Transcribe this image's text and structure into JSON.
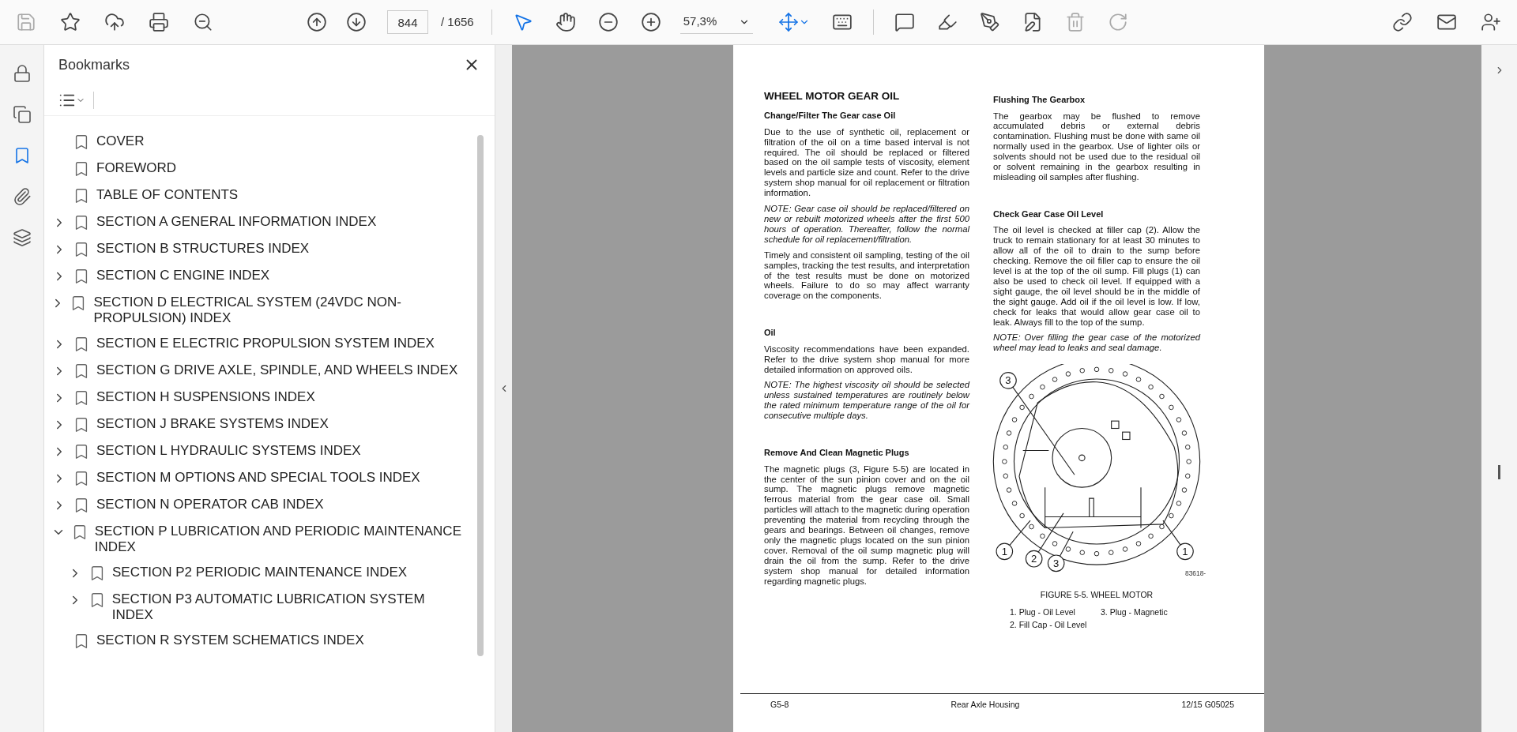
{
  "toolbar": {
    "page_current": "844",
    "page_total": "/ 1656",
    "zoom": "57,3%"
  },
  "rail": [
    {
      "kind": "lock",
      "selected": false
    },
    {
      "kind": "pages",
      "selected": false
    },
    {
      "kind": "bookmarks",
      "selected": true
    },
    {
      "kind": "attachments",
      "selected": false
    },
    {
      "kind": "layers",
      "selected": false
    }
  ],
  "bookmarks": {
    "title": "Bookmarks",
    "items": [
      {
        "label": "COVER"
      },
      {
        "label": "FOREWORD"
      },
      {
        "label": "TABLE OF CONTENTS"
      },
      {
        "label": "SECTION A GENERAL INFORMATION INDEX",
        "expanded": false
      },
      {
        "label": "SECTION B STRUCTURES INDEX",
        "expanded": false
      },
      {
        "label": "SECTION C ENGINE INDEX",
        "expanded": false
      },
      {
        "label": "SECTION D ELECTRICAL SYSTEM (24VDC NON-PROPULSION) INDEX",
        "expanded": false
      },
      {
        "label": "SECTION E ELECTRIC PROPULSION SYSTEM INDEX",
        "expanded": false
      },
      {
        "label": "SECTION G DRIVE AXLE, SPINDLE, AND WHEELS INDEX",
        "expanded": false
      },
      {
        "label": "SECTION H SUSPENSIONS INDEX",
        "expanded": false
      },
      {
        "label": "SECTION J BRAKE SYSTEMS INDEX",
        "expanded": false
      },
      {
        "label": "SECTION L HYDRAULIC SYSTEMS INDEX",
        "expanded": false
      },
      {
        "label": "SECTION M OPTIONS AND SPECIAL TOOLS INDEX",
        "expanded": false
      },
      {
        "label": "SECTION N OPERATOR CAB INDEX",
        "expanded": false
      },
      {
        "label": "SECTION P LUBRICATION AND PERIODIC MAINTENANCE INDEX",
        "expanded": true,
        "children": [
          {
            "label": "SECTION P2 PERIODIC MAINTENANCE INDEX",
            "expanded": false
          },
          {
            "label": "SECTION P3 AUTOMATIC LUBRICATION SYSTEM INDEX",
            "expanded": false
          }
        ]
      },
      {
        "label": "SECTION R SYSTEM SCHEMATICS INDEX"
      }
    ]
  },
  "page": {
    "left_column": [
      {
        "kind": "title",
        "text": "WHEEL MOTOR GEAR OIL"
      },
      {
        "kind": "heading",
        "text": "Change/Filter The Gear case Oil"
      },
      {
        "kind": "para",
        "text": "Due to the use of synthetic oil, replacement or filtration of the oil on a time based interval is not required. The oil should be replaced or filtered based on the oil sample tests of viscosity, element levels and particle size and count. Refer to the drive system shop manual for oil replacement or filtration information."
      },
      {
        "kind": "note",
        "text": "NOTE: Gear case oil should be replaced/filtered on new or rebuilt motorized wheels after the first 500 hours of operation. Thereafter, follow the normal schedule for oil replacement/filtration."
      },
      {
        "kind": "para",
        "text": "Timely and consistent oil sampling, testing of the oil samples, tracking the test results, and interpretation of the test results must be done on motorized wheels. Failure to do so may affect warranty coverage on the components."
      },
      {
        "kind": "section",
        "text": "Oil"
      },
      {
        "kind": "para",
        "text": "Viscosity recommendations have been expanded. Refer to the drive system shop manual for more detailed information on approved oils."
      },
      {
        "kind": "note",
        "text": "NOTE: The highest viscosity oil should be selected unless sustained temperatures are routinely below the rated minimum temperature range of the oil for consecutive multiple days."
      },
      {
        "kind": "section",
        "text": "Remove And Clean Magnetic Plugs"
      },
      {
        "kind": "para",
        "text": "The magnetic plugs (3, Figure 5-5) are located in the center of the sun pinion cover and on the oil sump. The magnetic plugs remove magnetic ferrous material from the gear case oil. Small particles will attach to the magnetic during operation preventing the material from recycling through the gears and bearings. Between oil changes, remove only the magnetic plugs located on the sun pinion cover. Removal of the oil sump magnetic plug will drain the oil from the sump. Refer to the drive system shop manual for detailed information regarding magnetic plugs."
      }
    ],
    "right_column": [
      {
        "kind": "heading",
        "text": "Flushing The Gearbox"
      },
      {
        "kind": "para",
        "text": "The gearbox may be flushed to remove accumulated debris or external debris contamination. Flushing must be done with same oil normally used in the gearbox. Use of lighter oils or solvents should not be used due to the residual oil or solvent remaining in the gearbox resulting in misleading oil samples after flushing."
      },
      {
        "kind": "section",
        "text": "Check Gear Case Oil Level"
      },
      {
        "kind": "para",
        "text": "The oil level is checked at filler cap (2). Allow the truck to remain stationary for at least 30 minutes to allow all of the oil to drain to the sump before checking. Remove the oil filler cap to ensure the oil level is at the top of the oil sump. Fill plugs (1) can also be used to check oil level. If equipped with a sight gauge, the oil level should be in the middle of the sight gauge. Add oil if the oil level is low. If low, check for leaks that would allow gear case oil to leak. Always fill to the top of the sump."
      },
      {
        "kind": "note",
        "text": "NOTE: Over filling the gear case of the motorized wheel may lead to leaks and seal damage."
      }
    ],
    "figure": {
      "callouts": [
        "3",
        "1",
        "2",
        "3",
        "1"
      ],
      "code": "83618-",
      "caption": "FIGURE 5-5. WHEEL MOTOR",
      "legend": [
        "1. Plug - Oil Level",
        "3. Plug - Magnetic",
        "2. Fill Cap - Oil Level"
      ]
    },
    "footer": {
      "left": "G5-8",
      "center": "Rear Axle Housing",
      "right": "12/15 G05025"
    }
  }
}
